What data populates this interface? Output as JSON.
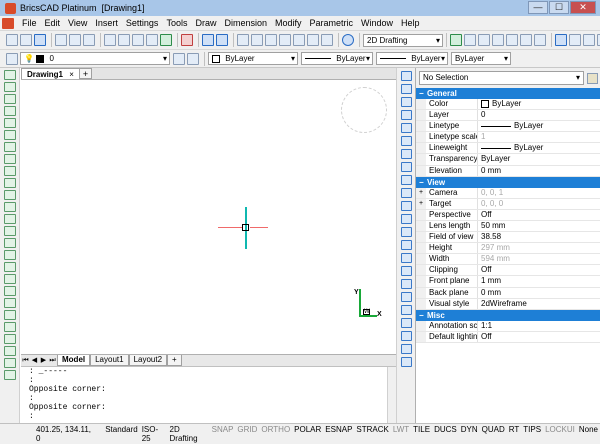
{
  "window": {
    "app_name": "BricsCAD Platinum",
    "doc_name": "[Drawing1]",
    "min": "—",
    "max": "☐",
    "close": "✕"
  },
  "menu": [
    "File",
    "Edit",
    "View",
    "Insert",
    "Settings",
    "Tools",
    "Draw",
    "Dimension",
    "Modify",
    "Parametric",
    "Window",
    "Help"
  ],
  "toolbar": {
    "workspace": "2D Drafting"
  },
  "layer_bar": {
    "layer": "0",
    "color": "ByLayer",
    "linetype": "ByLayer",
    "lineweight": "ByLayer",
    "plotstyle": "ByLayer"
  },
  "document_tab": {
    "label": "Drawing1",
    "close": "×",
    "add": "+"
  },
  "layout_tabs": [
    "Model",
    "Layout1",
    "Layout2"
  ],
  "layout_add": "+",
  "command_lines": [
    ": _-----",
    ":",
    "Opposite corner:",
    ":",
    "Opposite corner:",
    ":"
  ],
  "properties": {
    "selection": "No Selection",
    "sections": [
      {
        "name": "General",
        "toggle": "−",
        "rows": [
          {
            "key": "Color",
            "value": "ByLayer",
            "swatch": true
          },
          {
            "key": "Layer",
            "value": "0"
          },
          {
            "key": "Linetype",
            "value": "ByLayer",
            "line": true
          },
          {
            "key": "Linetype scale",
            "value": "1",
            "dim": true
          },
          {
            "key": "Lineweight",
            "value": "ByLayer",
            "line": true
          },
          {
            "key": "Transparency",
            "value": "ByLayer"
          },
          {
            "key": "Elevation",
            "value": "0 mm"
          }
        ]
      },
      {
        "name": "View",
        "toggle": "−",
        "rows": [
          {
            "key": "Camera",
            "value": "0, 0, 1",
            "dim": true,
            "expand": "+"
          },
          {
            "key": "Target",
            "value": "0, 0, 0",
            "dim": true,
            "expand": "+"
          },
          {
            "key": "Perspective",
            "value": "Off"
          },
          {
            "key": "Lens length",
            "value": "50 mm"
          },
          {
            "key": "Field of view",
            "value": "38.58"
          },
          {
            "key": "Height",
            "value": "297 mm",
            "dim": true
          },
          {
            "key": "Width",
            "value": "594 mm",
            "dim": true
          },
          {
            "key": "Clipping",
            "value": "Off"
          },
          {
            "key": "Front plane",
            "value": "1 mm"
          },
          {
            "key": "Back plane",
            "value": "0 mm"
          },
          {
            "key": "Visual style",
            "value": "2dWireframe"
          }
        ]
      },
      {
        "name": "Misc",
        "toggle": "−",
        "rows": [
          {
            "key": "Annotation scale",
            "value": "1:1"
          },
          {
            "key": "Default lighting",
            "value": "Off"
          }
        ]
      }
    ]
  },
  "status": {
    "coords": "401.25, 134.11, 0",
    "items": [
      {
        "label": "Standard",
        "on": true
      },
      {
        "label": "ISO-25",
        "on": true
      },
      {
        "label": "2D Drafting",
        "on": true
      },
      {
        "label": "SNAP",
        "on": false
      },
      {
        "label": "GRID",
        "on": false
      },
      {
        "label": "ORTHO",
        "on": false
      },
      {
        "label": "POLAR",
        "on": true
      },
      {
        "label": "ESNAP",
        "on": true
      },
      {
        "label": "STRACK",
        "on": true
      },
      {
        "label": "LWT",
        "on": false
      },
      {
        "label": "TILE",
        "on": true
      },
      {
        "label": "DUCS",
        "on": true
      },
      {
        "label": "DYN",
        "on": true
      },
      {
        "label": "QUAD",
        "on": true
      },
      {
        "label": "RT",
        "on": true
      },
      {
        "label": "TIPS",
        "on": true
      },
      {
        "label": "LOCKUI",
        "on": false
      },
      {
        "label": "None",
        "on": true
      }
    ]
  },
  "ucs": {
    "y": "Y",
    "x": "X",
    "w": "W"
  }
}
